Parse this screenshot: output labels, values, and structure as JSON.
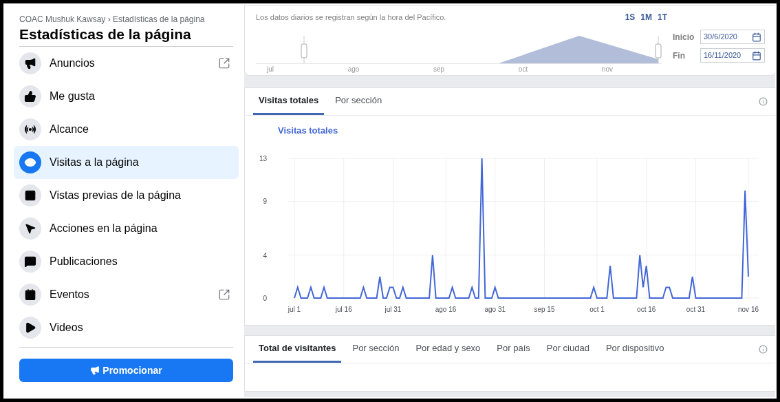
{
  "breadcrumb": {
    "parent": "COAC Mushuk Kawsay",
    "separator": "›",
    "current": "Estadísticas de la página"
  },
  "title": "Estadísticas de la página",
  "nav": [
    {
      "label": "Anuncios",
      "selected": false,
      "external": true
    },
    {
      "label": "Me gusta",
      "selected": false,
      "external": false
    },
    {
      "label": "Alcance",
      "selected": false,
      "external": false
    },
    {
      "label": "Visitas a la página",
      "selected": true,
      "external": false
    },
    {
      "label": "Vistas previas de la página",
      "selected": false,
      "external": false
    },
    {
      "label": "Acciones en la página",
      "selected": false,
      "external": false
    },
    {
      "label": "Publicaciones",
      "selected": false,
      "external": false
    },
    {
      "label": "Eventos",
      "selected": false,
      "external": true
    },
    {
      "label": "Videos",
      "selected": false,
      "external": false
    }
  ],
  "promote_button": "Promocionar",
  "range": {
    "note": "Los datos diarios se registran según la hora del Pacífico.",
    "presets": [
      "1S",
      "1M",
      "1T"
    ],
    "months": [
      "jul",
      "ago",
      "sep",
      "oct",
      "nov"
    ],
    "start": {
      "label": "Inicio",
      "value": "30/6/2020"
    },
    "end": {
      "label": "Fin",
      "value": "16/11/2020"
    }
  },
  "chart_card": {
    "tabs": [
      {
        "label": "Visitas totales",
        "selected": true
      },
      {
        "label": "Por sección",
        "selected": false
      }
    ],
    "chart_data": {
      "type": "line",
      "title": "Visitas totales",
      "ylim": [
        0,
        13
      ],
      "yticks": [
        0,
        4,
        9,
        13
      ],
      "categories": [
        "jul 1",
        null,
        null,
        null,
        null,
        null,
        null,
        null,
        null,
        null,
        null,
        null,
        null,
        null,
        null,
        "jul 16",
        null,
        null,
        null,
        null,
        null,
        null,
        null,
        null,
        null,
        null,
        null,
        null,
        null,
        null,
        "jul 31",
        null,
        null,
        null,
        null,
        null,
        null,
        null,
        null,
        null,
        null,
        null,
        null,
        null,
        null,
        null,
        "ago 16",
        null,
        null,
        null,
        null,
        null,
        null,
        null,
        null,
        null,
        null,
        null,
        null,
        null,
        null,
        "ago 31",
        null,
        null,
        null,
        null,
        null,
        null,
        null,
        null,
        null,
        null,
        null,
        null,
        null,
        null,
        "sep 15",
        null,
        null,
        null,
        null,
        null,
        null,
        null,
        null,
        null,
        null,
        null,
        null,
        null,
        null,
        null,
        "oct 1",
        null,
        null,
        null,
        null,
        null,
        null,
        null,
        null,
        null,
        null,
        null,
        null,
        null,
        null,
        "oct 16",
        null,
        null,
        null,
        null,
        null,
        null,
        null,
        null,
        null,
        null,
        null,
        null,
        null,
        null,
        "oct 31",
        null,
        null,
        null,
        null,
        null,
        null,
        null,
        null,
        null,
        null,
        null,
        null,
        null,
        null,
        null,
        "nov 16"
      ],
      "series": [
        {
          "color": "#4267d6",
          "values": [
            0,
            1,
            0,
            0,
            0,
            1,
            0,
            0,
            0,
            1,
            0,
            0,
            0,
            0,
            0,
            0,
            0,
            0,
            0,
            0,
            0,
            1,
            0,
            0,
            0,
            0,
            2,
            0,
            0,
            1,
            1,
            0,
            0,
            1,
            0,
            0,
            0,
            0,
            0,
            0,
            0,
            0,
            4,
            0,
            0,
            0,
            0,
            0,
            1,
            0,
            0,
            0,
            0,
            0,
            1,
            0,
            0,
            13,
            0,
            0,
            0,
            1,
            0,
            0,
            0,
            0,
            0,
            0,
            0,
            0,
            0,
            0,
            0,
            0,
            0,
            0,
            0,
            0,
            0,
            0,
            0,
            0,
            0,
            0,
            0,
            0,
            0,
            0,
            0,
            0,
            0,
            1,
            0,
            0,
            0,
            0,
            3,
            0,
            0,
            0,
            0,
            0,
            0,
            0,
            0,
            4,
            1,
            3,
            0,
            0,
            0,
            0,
            0,
            1,
            1,
            0,
            0,
            0,
            0,
            0,
            0,
            2,
            0,
            0,
            0,
            0,
            0,
            0,
            0,
            0,
            0,
            0,
            0,
            0,
            0,
            0,
            0,
            10,
            2
          ]
        }
      ]
    }
  },
  "bottom_tabs": [
    {
      "label": "Total de visitantes",
      "selected": true
    },
    {
      "label": "Por sección",
      "selected": false
    },
    {
      "label": "Por edad y sexo",
      "selected": false
    },
    {
      "label": "Por país",
      "selected": false
    },
    {
      "label": "Por ciudad",
      "selected": false
    },
    {
      "label": "Por dispositivo",
      "selected": false
    }
  ]
}
